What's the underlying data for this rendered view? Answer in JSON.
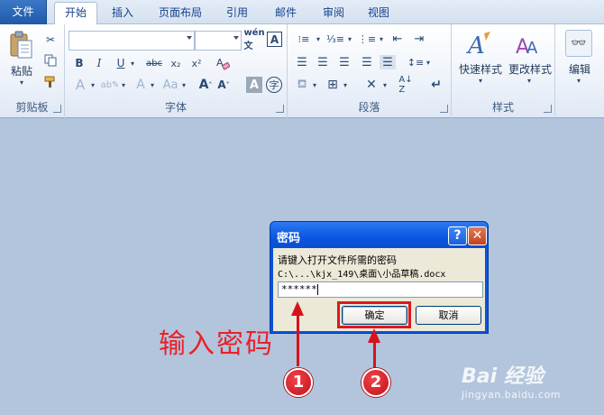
{
  "tabs": [
    {
      "label": "文件"
    },
    {
      "label": "开始"
    },
    {
      "label": "插入"
    },
    {
      "label": "页面布局"
    },
    {
      "label": "引用"
    },
    {
      "label": "邮件"
    },
    {
      "label": "审阅"
    },
    {
      "label": "视图"
    }
  ],
  "ribbon": {
    "clipboard": {
      "label": "剪贴板",
      "paste": "粘贴"
    },
    "font": {
      "label": "字体",
      "font_name": "",
      "font_size": ""
    },
    "paragraph": {
      "label": "段落"
    },
    "styles": {
      "label": "样式",
      "quick_styles": "快速样式",
      "change_styles": "更改样式"
    },
    "editing": {
      "label": "编辑"
    }
  },
  "dialog": {
    "title": "密码",
    "help": "?",
    "close": "✕",
    "prompt": "请键入打开文件所需的密码",
    "path": "C:\\...\\kjx_149\\桌面\\小品草稿.docx",
    "password_mask": "******",
    "ok_label": "确定",
    "cancel_label": "取消"
  },
  "annotation": {
    "text": "输入密码",
    "badge1": "1",
    "badge2": "2",
    "color": "#e8202a"
  },
  "watermark": {
    "logo": "Bai 经验",
    "url": "jingyan.baidu.com"
  },
  "colors": {
    "workspace": "#b3c5dc",
    "title_blue": "#0a56e0"
  }
}
